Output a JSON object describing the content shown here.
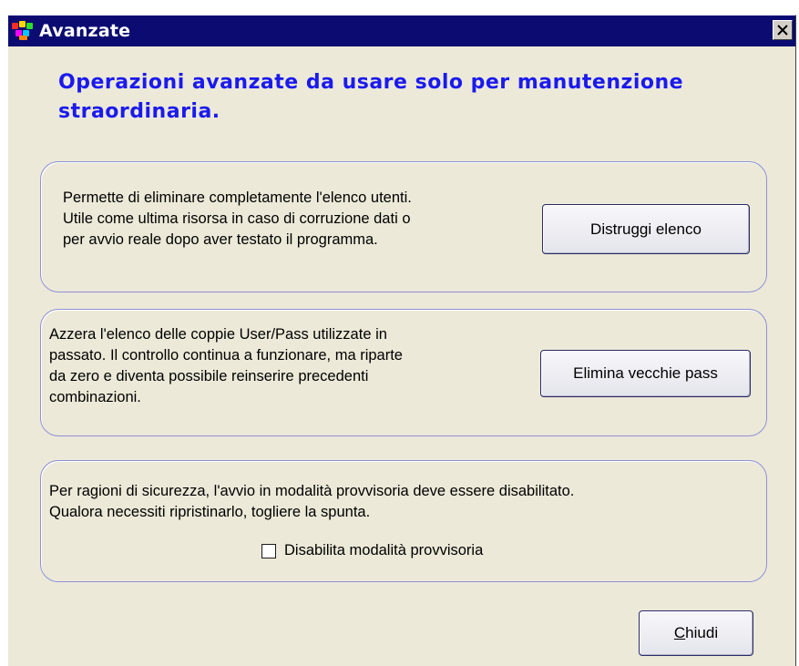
{
  "window": {
    "title": "Avanzate",
    "icon": "app-icon",
    "close_icon": "close-x-icon"
  },
  "heading": {
    "line1": "Operazioni avanzate da usare solo per manutenzione",
    "line2": "straordinaria."
  },
  "group_users": {
    "lines": [
      "Permette di eliminare completamente l'elenco utenti.",
      "Utile come ultima risorsa in caso di corruzione dati o",
      "per avvio reale dopo aver testato il programma."
    ],
    "button_label": "Distruggi elenco"
  },
  "group_pass": {
    "lines": [
      "Azzera l'elenco delle coppie User/Pass utilizzate in",
      "passato. Il controllo continua a funzionare, ma riparte",
      "da zero e diventa possibile reinserire precedenti",
      "combinazioni."
    ],
    "button_label": "Elimina vecchie pass"
  },
  "group_safe_mode": {
    "lines": [
      "Per ragioni di sicurezza, l'avvio in modalità provvisoria deve essere disabilitato.",
      "Qualora necessiti ripristinarlo, togliere la spunta."
    ],
    "checkbox_label": "Disabilita modalità provvisoria",
    "checkbox_checked": false
  },
  "footer": {
    "close_mnemonic": "C",
    "close_rest": "hiudi"
  },
  "colors": {
    "titlebar": "#0b0b72",
    "heading": "#1a1aee",
    "group_border": "#8f8fd8",
    "window_bg": "#ece9d8"
  }
}
